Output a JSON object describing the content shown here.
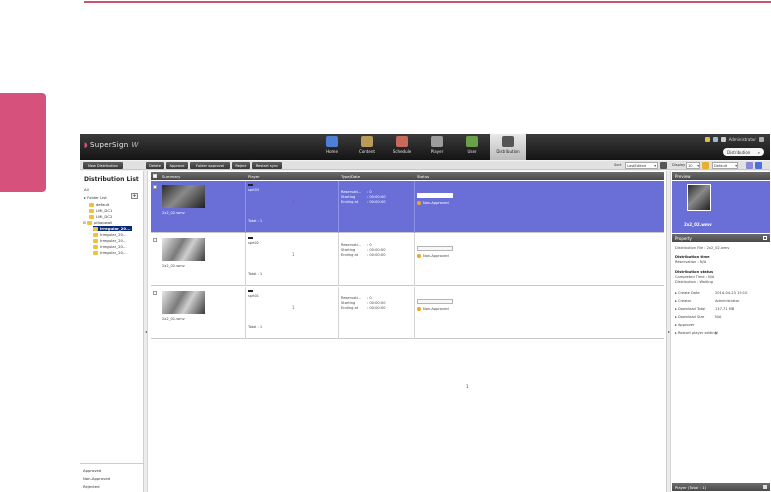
{
  "app": {
    "logo": "SuperSign",
    "version": "W"
  },
  "nav": [
    {
      "label": "Home",
      "icon": "home-icon"
    },
    {
      "label": "Content",
      "icon": "content-icon"
    },
    {
      "label": "Schedule",
      "icon": "schedule-icon"
    },
    {
      "label": "Player",
      "icon": "player-icon"
    },
    {
      "label": "User",
      "icon": "user-icon"
    },
    {
      "label": "Distribution",
      "icon": "distribution-icon",
      "active": true
    }
  ],
  "header_right": {
    "admin": "Administrator",
    "select": "Distribution"
  },
  "toolbar": {
    "new_distribution": "New Distribution",
    "delete": "Delete",
    "approve": "Approve",
    "folder_approval": "Folder approval",
    "reject": "Reject",
    "restart_sync": "Restart sync",
    "sort_label": "Sort",
    "sort_value": "LastEdited",
    "display_label": "Display",
    "display_value": "10",
    "view_value": "Default"
  },
  "left": {
    "title": "Distribution List",
    "all": "All",
    "folder_list": "Folder List",
    "add": "+",
    "tree": [
      "default",
      "LMI_DC1",
      "LMI_DC2",
      "plitapwall",
      "Irregular_20...",
      "Irregular_20...",
      "Irregular_20...",
      "Irregular_20...",
      "Irregular_20..."
    ],
    "footer": [
      "Approved",
      "Non-Approved",
      "Rejected"
    ]
  },
  "table": {
    "headers": {
      "summary": "Summary",
      "player": "Player",
      "type": "Type/Date",
      "status": "Status"
    },
    "rows": [
      {
        "file": "2x2_02.wmv",
        "player": "sprt03",
        "mark": "1",
        "total": "Total : 1",
        "reservation_label": "Reservati...",
        "reservation_value": ": 0",
        "starting_label": "Starting",
        "starting_value": ": 00:00:00",
        "ending_label": "Ending at",
        "ending_value": ": 00:00:00",
        "status": "Non-Approved",
        "selected": true
      },
      {
        "file": "2x2_02.wmv",
        "player": "sprt02",
        "mark": "1",
        "total": "Total : 1",
        "reservation_label": "Reservati...",
        "reservation_value": ": 0",
        "starting_label": "Starting",
        "starting_value": ": 00:00:00",
        "ending_label": "Ending at",
        "ending_value": ": 00:00:00",
        "status": "Non-Approved",
        "selected": false
      },
      {
        "file": "2x2_01.wmv",
        "player": "sprt01",
        "mark": "1",
        "total": "Total : 1",
        "reservation_label": "Reservati...",
        "reservation_value": ": 0",
        "starting_label": "Starting",
        "starting_value": ": 00:00:00",
        "ending_label": "Ending at",
        "ending_value": ": 00:00:00",
        "status": "Non-Approved",
        "selected": false
      }
    ],
    "page": "1"
  },
  "right": {
    "preview_title": "Preview",
    "preview_name": "2x2_02.wmv",
    "property_title": "Property",
    "dist_file": "Distribution File : 2x2_02.wmv",
    "dist_time_title": "Distribution time",
    "reservation": "Reservation : N/A",
    "dist_status_title": "Distribution status",
    "completed": "Completed Time : N/A",
    "distribution": "Distribution : Waiting",
    "props": [
      {
        "key": "Create Date",
        "value": "2014-04-23 15:10"
      },
      {
        "key": "Creator",
        "value": "Administrator"
      },
      {
        "key": "Download Total",
        "value": "137.71 MB"
      },
      {
        "key": "Download Size",
        "value": "N/A"
      },
      {
        "key": "Approver",
        "value": ""
      },
      {
        "key": "Restart player setting",
        "value": "N"
      }
    ],
    "player_bar": "Player (Total : 1)"
  },
  "colors": {
    "accent": "#d6527c",
    "selected_row": "#6a6fd8",
    "header_dark": "#1f1f1f"
  }
}
